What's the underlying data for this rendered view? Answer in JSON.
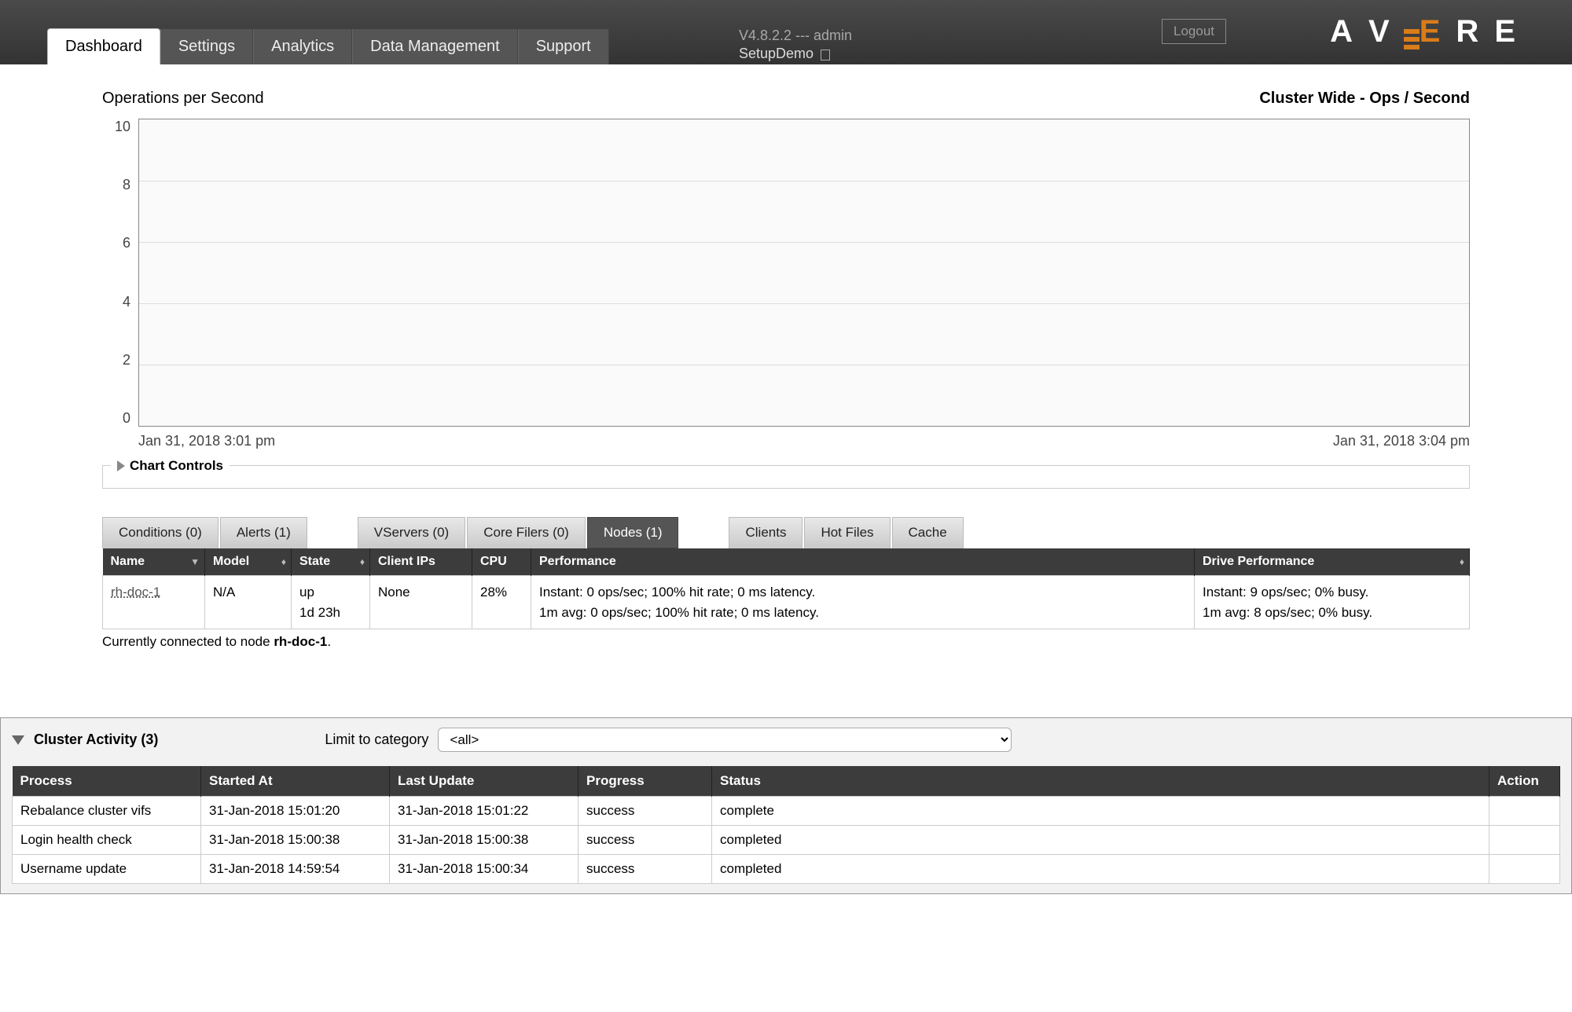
{
  "header": {
    "logout": "Logout",
    "version": "V4.8.2.2 --- admin",
    "cluster": "SetupDemo",
    "logo_letters": [
      "A",
      "V",
      "E",
      "R",
      "E"
    ]
  },
  "nav": {
    "tabs": [
      "Dashboard",
      "Settings",
      "Analytics",
      "Data Management",
      "Support"
    ],
    "active": "Dashboard"
  },
  "chart_data": {
    "type": "line",
    "title_left": "Operations per Second",
    "title_right": "Cluster Wide - Ops / Second",
    "y_ticks": [
      "10",
      "8",
      "6",
      "4",
      "2",
      "0"
    ],
    "ylim": [
      0,
      10
    ],
    "x_start": "Jan 31, 2018 3:01 pm",
    "x_end": "Jan 31, 2018 3:04 pm",
    "series": [],
    "xlabel": "",
    "ylabel": ""
  },
  "chart_controls_label": "Chart Controls",
  "subtabs": {
    "left": [
      "Conditions (0)",
      "Alerts (1)"
    ],
    "mid": [
      "VServers (0)",
      "Core Filers (0)",
      "Nodes (1)"
    ],
    "right": [
      "Clients",
      "Hot Files",
      "Cache"
    ],
    "active": "Nodes (1)"
  },
  "nodes_table": {
    "columns": [
      "Name",
      "Model",
      "State",
      "Client IPs",
      "CPU",
      "Performance",
      "Drive Performance"
    ],
    "row": {
      "name": "rh-doc-1",
      "model": "N/A",
      "state": "up\n1d 23h",
      "client_ips": "None",
      "cpu": "28%",
      "performance": "Instant:  0 ops/sec; 100% hit rate; 0 ms latency.\n1m avg: 0 ops/sec; 100% hit rate; 0 ms latency.",
      "drive_performance": "Instant:   9 ops/sec;  0% busy.\n1m avg:  8 ops/sec;  0% busy."
    },
    "connected_prefix": "Currently connected to node ",
    "connected_node": "rh-doc-1",
    "connected_suffix": "."
  },
  "cluster_activity": {
    "title": "Cluster Activity (3)",
    "limit_label": "Limit to category",
    "select_value": "<all>",
    "columns": [
      "Process",
      "Started At",
      "Last Update",
      "Progress",
      "Status",
      "Action"
    ],
    "rows": [
      {
        "process": "Rebalance cluster vifs",
        "started": "31-Jan-2018 15:01:20",
        "updated": "31-Jan-2018 15:01:22",
        "progress": "success",
        "status": "complete",
        "action": ""
      },
      {
        "process": "Login health check",
        "started": "31-Jan-2018 15:00:38",
        "updated": "31-Jan-2018 15:00:38",
        "progress": "success",
        "status": "completed",
        "action": ""
      },
      {
        "process": "Username update",
        "started": "31-Jan-2018 14:59:54",
        "updated": "31-Jan-2018 15:00:34",
        "progress": "success",
        "status": "completed",
        "action": ""
      }
    ]
  }
}
